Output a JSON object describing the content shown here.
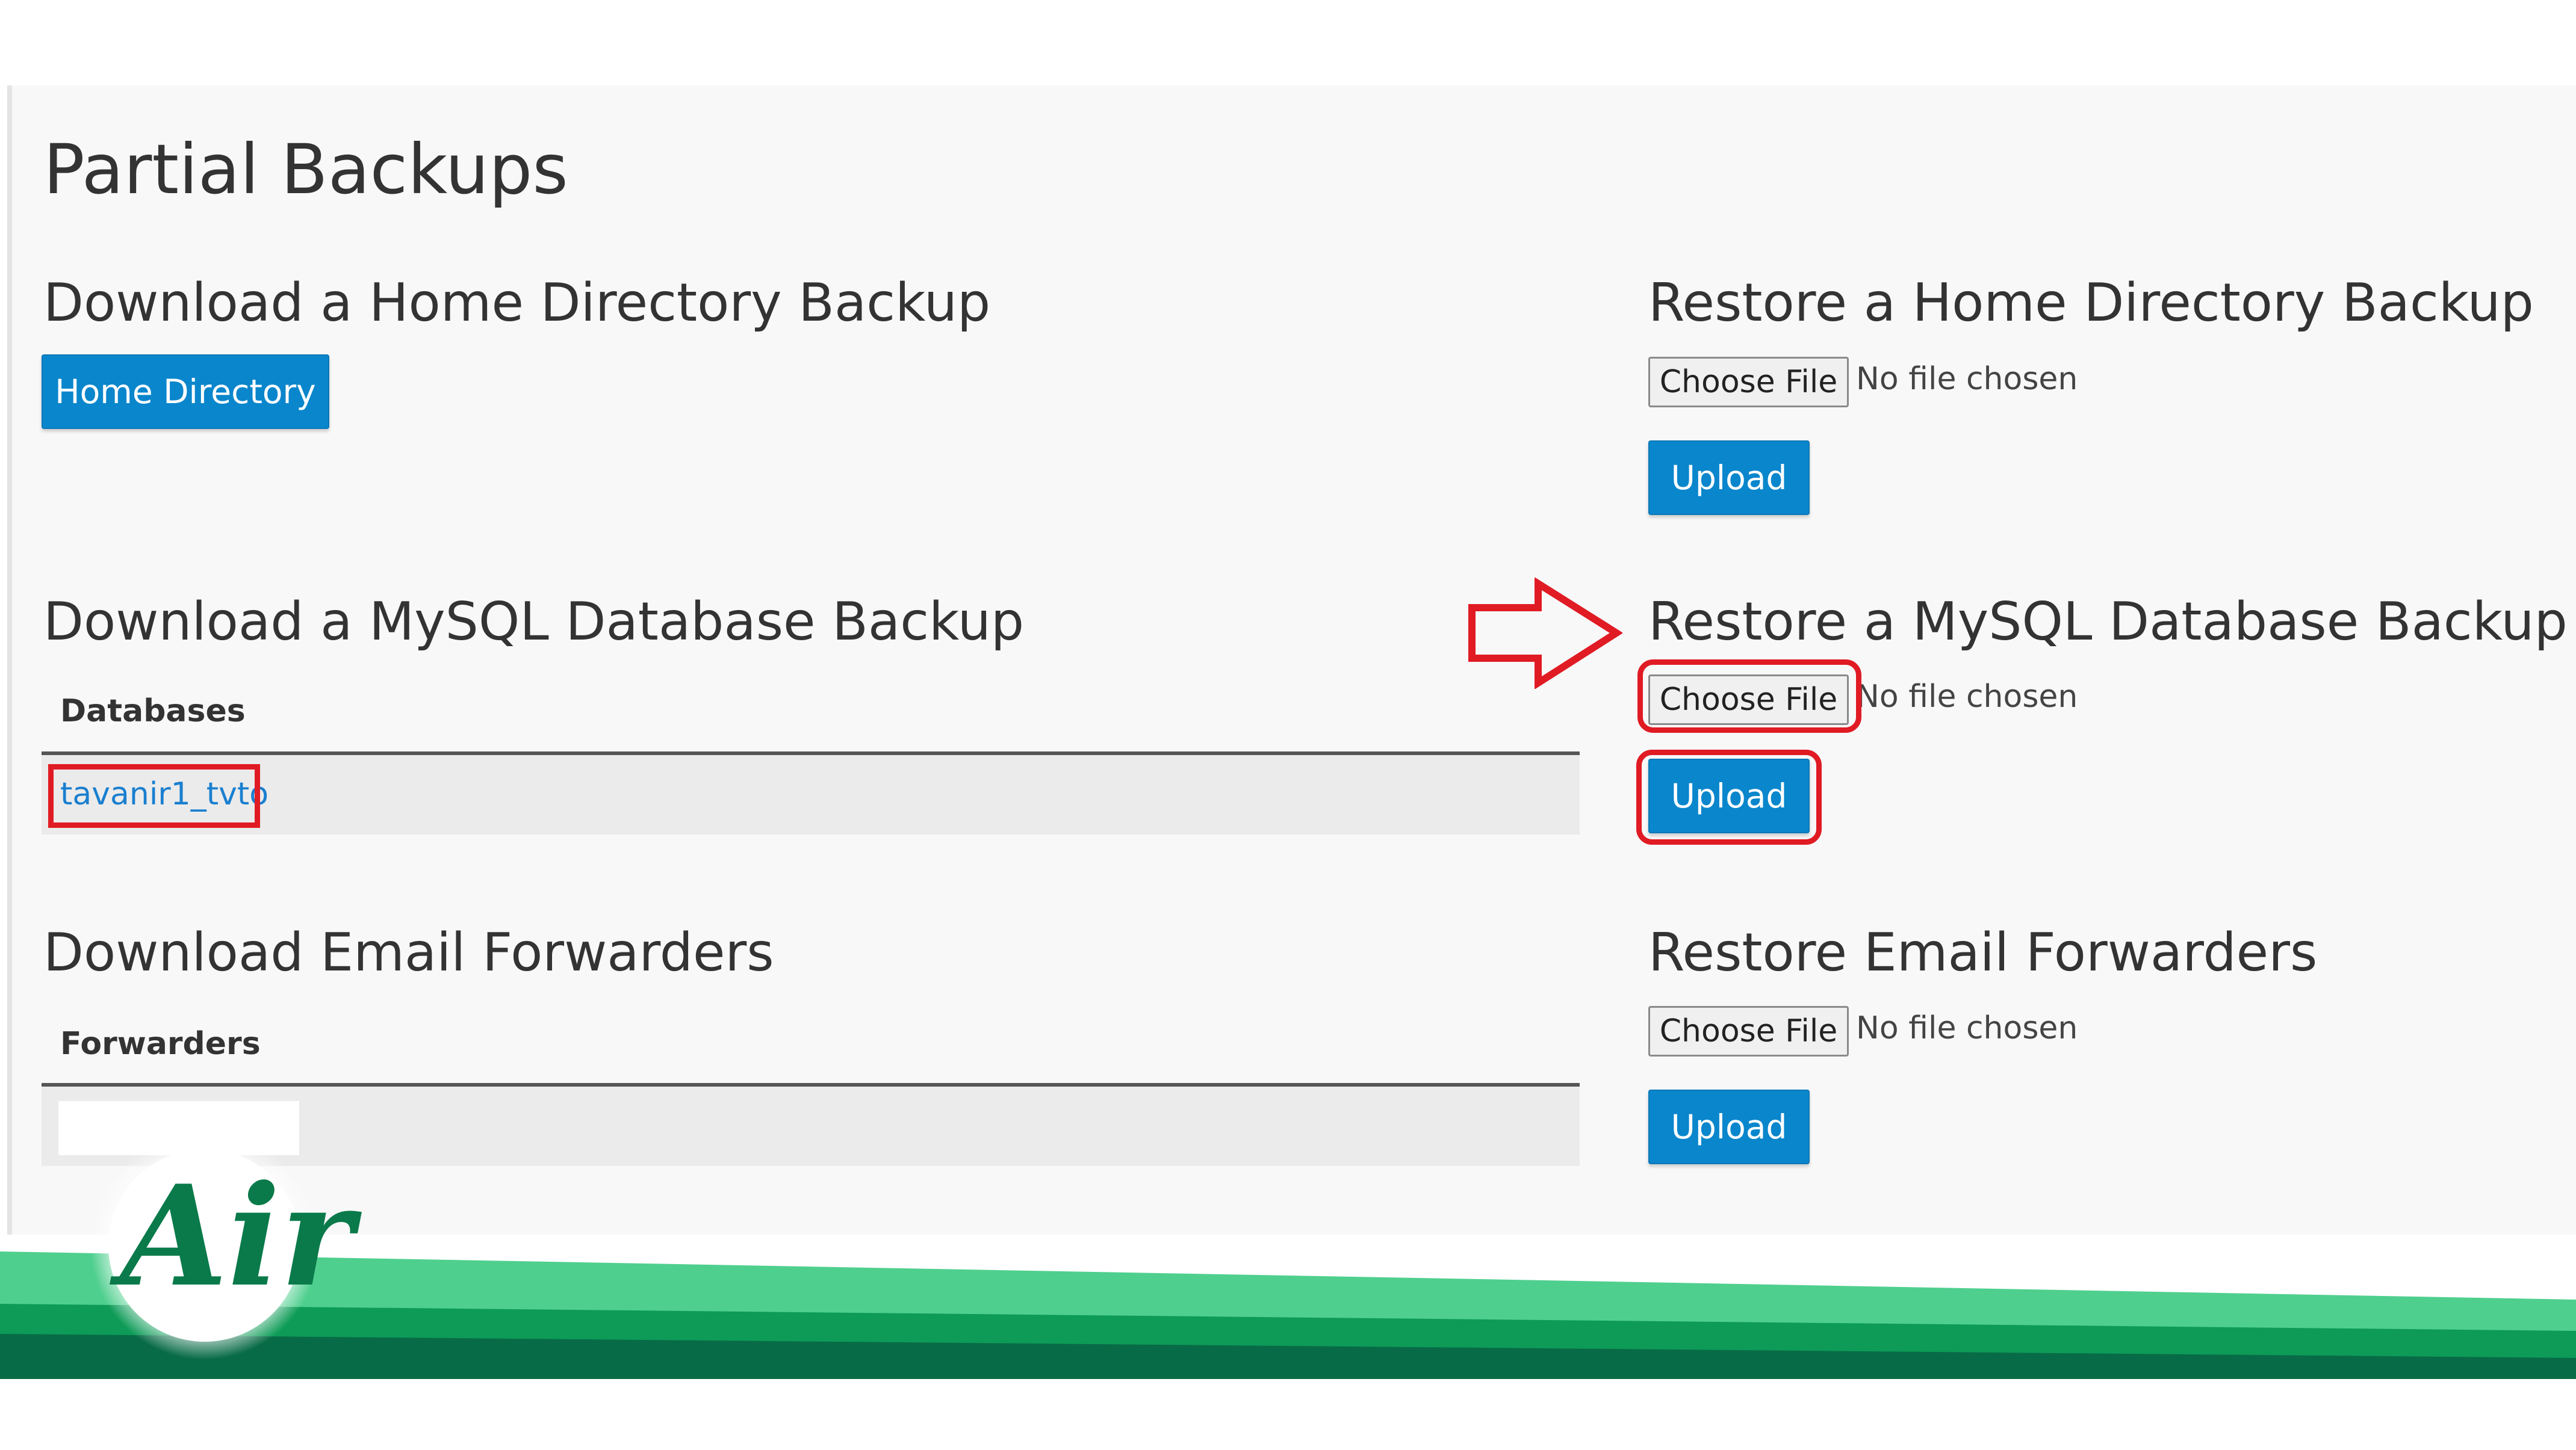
{
  "page": {
    "title": "Partial Backups"
  },
  "home": {
    "download_heading": "Download a Home Directory Backup",
    "download_button": "Home Directory",
    "restore_heading": "Restore a Home Directory Backup",
    "choose_file": "Choose File",
    "no_file": "No file chosen",
    "upload": "Upload"
  },
  "mysql": {
    "download_heading": "Download a MySQL Database Backup",
    "table_header": "Databases",
    "databases": [
      "tavanir1_tvto"
    ],
    "restore_heading": "Restore a MySQL Database Backup",
    "choose_file": "Choose File",
    "no_file": "No file chosen",
    "upload": "Upload"
  },
  "email": {
    "download_heading": "Download Email Forwarders",
    "table_header": "Forwarders",
    "restore_heading": "Restore Email Forwarders",
    "choose_file": "Choose File",
    "no_file": "No file chosen",
    "upload": "Upload"
  },
  "annotation_color": "#e01b24",
  "accent_color": "#0a86cc",
  "logo": {
    "text": "Air",
    "color": "#0a7a4a"
  },
  "icons": {
    "arrow": "arrow-right-icon",
    "logo": "air-logo-icon"
  }
}
